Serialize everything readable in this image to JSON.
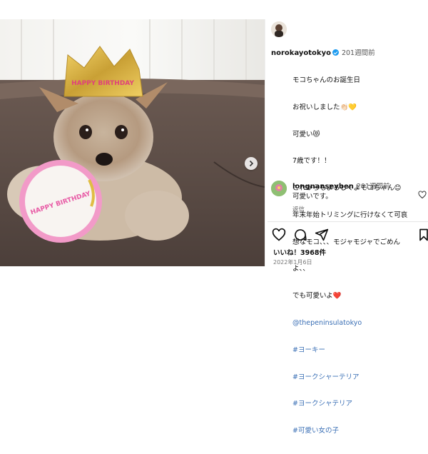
{
  "post": {
    "username": "norokayotokyo",
    "time_ago": "201週間前",
    "caption_lines": [
      "モコちゃんのお誕生日",
      "お祝いしました👏🏻💛",
      "可愛い😻",
      "7歳です！！",
      "これからもよろしくよモコちゃん😊",
      "年末年始トリミングに行けなくて可哀",
      "想なモコ、、、モジャモジャでごめん",
      "よ、、",
      "でも可愛いよ❤️"
    ],
    "mention": "@thepeninsulatokyo",
    "hashtags": [
      "#ヨーキー",
      "#ヨークシャーテリア",
      "#ヨークシャテリア",
      "#可愛い女の子"
    ]
  },
  "comment": {
    "username": "longnanseyben",
    "time_ago": "201週間前",
    "text": "可愛いです。",
    "reply_label": "返信"
  },
  "likes": "いいね！3968件",
  "date": "2022年1月6日",
  "photo": {
    "crown_text": "HAPPY BIRTHDAY",
    "bib_text": "HAPPY BIRTHDAY"
  },
  "icons": {
    "next": "chevron-right-icon",
    "like": "heart-icon",
    "comment": "comment-icon",
    "share": "send-icon",
    "save": "bookmark-icon",
    "verified": "verified-badge-icon"
  },
  "colors": {
    "link": "#3a6fb5",
    "verified": "#1d9bf0",
    "bib_pink": "#e85aa5"
  }
}
